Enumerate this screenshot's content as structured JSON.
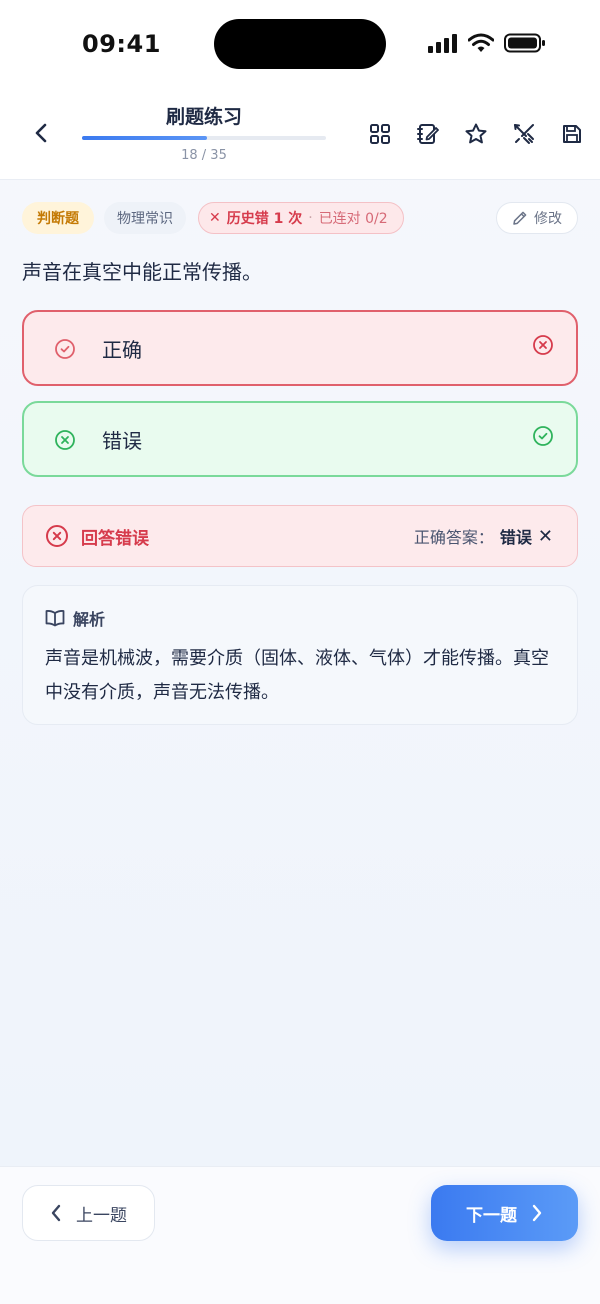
{
  "status_bar": {
    "time": "09:41"
  },
  "nav": {
    "title": "刷题练习",
    "progress_text": "18 / 35",
    "progress_fraction": 0.514,
    "actions": [
      "grid-icon",
      "notebook-edit-icon",
      "star-icon",
      "sword-icon",
      "save-icon"
    ]
  },
  "tags": {
    "type": "判断题",
    "category": "物理常识",
    "history_prefix": "✕",
    "history_label": "历史错 1 次",
    "history_separator": "·",
    "streak": "已连对 0/2",
    "edit_label": "修改"
  },
  "question": {
    "text": "声音在真空中能正常传播。"
  },
  "options": [
    {
      "label": "正确",
      "state": "wrong"
    },
    {
      "label": "错误",
      "state": "correct"
    }
  ],
  "result": {
    "label": "回答错误",
    "answer_prefix": "正确答案：",
    "answer_value": "错误",
    "answer_mark": "✕"
  },
  "analysis": {
    "title": "解析",
    "body": "声音是机械波，需要介质（固体、液体、气体）才能传播。真空中没有介质，声音无法传播。"
  },
  "footer": {
    "prev_label": "上一题",
    "next_label": "下一题"
  },
  "colors": {
    "accent": "#3b7af0",
    "error": "#d63b4c",
    "success": "#2fb35c",
    "warning": "#c47a05"
  }
}
